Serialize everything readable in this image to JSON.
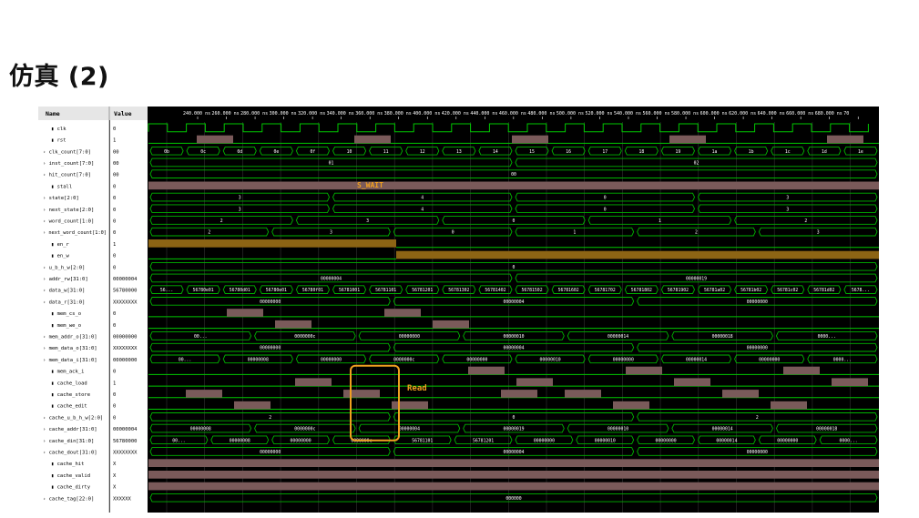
{
  "slide": {
    "title": "仿真 (2)"
  },
  "panel": {
    "name_header": "Name",
    "value_header": "Value"
  },
  "time_axis": [
    "240.000 ns",
    "260.000 ns",
    "280.000 ns",
    "300.000 ns",
    "320.000 ns",
    "340.000 ns",
    "360.000 ns",
    "380.000 ns",
    "400.000 ns",
    "420.000 ns",
    "440.000 ns",
    "460.000 ns",
    "480.000 ns",
    "500.000 ns",
    "520.000 ns",
    "540.000 ns",
    "560.000 ns",
    "580.000 ns",
    "600.000 ns",
    "620.000 ns",
    "640.000 ns",
    "660.000 ns",
    "680.000 ns",
    "70"
  ],
  "colors": {
    "signal_green": "#00c800",
    "bus_outline": "#00b400",
    "high_fill": "#7a5a5a",
    "en_r_fill": "#8c6414",
    "annotation_orange": "#f0a020",
    "background": "#000000"
  },
  "annotations": {
    "s_wait": "S_WAIT",
    "read": "Read"
  },
  "signals": [
    {
      "name": "clk",
      "value": "0",
      "kind": "bit"
    },
    {
      "name": "rst",
      "value": "1",
      "kind": "bit"
    },
    {
      "name": "clk_count[7:0]",
      "value": "00",
      "kind": "bus",
      "segs": [
        "0b",
        "0c",
        "0d",
        "0e",
        "0f",
        "10",
        "11",
        "12",
        "13",
        "14",
        "15",
        "16",
        "17",
        "18",
        "19",
        "1a",
        "1b",
        "1c",
        "1d",
        "1e"
      ]
    },
    {
      "name": "inst_count[7:0]",
      "value": "00",
      "kind": "bus",
      "segs": [
        "01",
        "02"
      ]
    },
    {
      "name": "hit_count[7:0]",
      "value": "00",
      "kind": "bus",
      "segs": [
        "00"
      ]
    },
    {
      "name": "stall",
      "value": "0",
      "kind": "bit"
    },
    {
      "name": "state[2:0]",
      "value": "0",
      "kind": "bus",
      "segs": [
        "3",
        "4",
        "0",
        "3"
      ]
    },
    {
      "name": "next_state[2:0]",
      "value": "0",
      "kind": "bus",
      "segs": [
        "3",
        "4",
        "0",
        "3"
      ]
    },
    {
      "name": "word_count[1:0]",
      "value": "0",
      "kind": "bus",
      "segs": [
        "2",
        "3",
        "0",
        "1",
        "2"
      ]
    },
    {
      "name": "next_word_count[1:0]",
      "value": "0",
      "kind": "bus",
      "segs": [
        "2",
        "3",
        "0",
        "1",
        "2",
        "3"
      ]
    },
    {
      "name": "en_r",
      "value": "1",
      "kind": "bit"
    },
    {
      "name": "en_w",
      "value": "0",
      "kind": "bit"
    },
    {
      "name": "u_b_h_w[2:0]",
      "value": "0",
      "kind": "bus",
      "segs": [
        "0"
      ]
    },
    {
      "name": "addr_rw[31:0]",
      "value": "00000004",
      "kind": "bus",
      "segs": [
        "00000004",
        "00000019"
      ]
    },
    {
      "name": "data_w[31:0]",
      "value": "56780000",
      "kind": "bus",
      "segs": [
        "56...",
        "56780e01",
        "56780d01",
        "56780e01",
        "56780f01",
        "56781001",
        "56781101",
        "56781201",
        "56781302",
        "56781402",
        "56781502",
        "56781602",
        "56781702",
        "56781802",
        "56781902",
        "56781a02",
        "56781b02",
        "56781c02",
        "56781d02",
        "5678..."
      ]
    },
    {
      "name": "data_r[31:0]",
      "value": "XXXXXXXX",
      "kind": "bus",
      "segs": [
        "00000000",
        "00000004",
        "00000000"
      ]
    },
    {
      "name": "mem_cs_o",
      "value": "0",
      "kind": "bit"
    },
    {
      "name": "mem_we_o",
      "value": "0",
      "kind": "bit"
    },
    {
      "name": "mem_addr_o[31:0]",
      "value": "00000000",
      "kind": "bus",
      "segs": [
        "00...",
        "0000000c",
        "00000000",
        "00000010",
        "00000014",
        "00000018",
        "0000..."
      ]
    },
    {
      "name": "mem_data_o[31:0]",
      "value": "XXXXXXXX",
      "kind": "bus",
      "segs": [
        "00000000",
        "00000004",
        "00000000"
      ]
    },
    {
      "name": "mem_data_i[31:0]",
      "value": "00000000",
      "kind": "bus",
      "segs": [
        "00...",
        "00000008",
        "00000000",
        "0000000c",
        "00000000",
        "00000010",
        "00000000",
        "00000014",
        "00000000",
        "0000..."
      ]
    },
    {
      "name": "mem_ack_i",
      "value": "0",
      "kind": "bit"
    },
    {
      "name": "cache_load",
      "value": "1",
      "kind": "bit"
    },
    {
      "name": "cache_store",
      "value": "0",
      "kind": "bit"
    },
    {
      "name": "cache_edit",
      "value": "0",
      "kind": "bit"
    },
    {
      "name": "cache_u_b_h_w[2:0]",
      "value": "0",
      "kind": "bus",
      "segs": [
        "2",
        "0",
        "2"
      ]
    },
    {
      "name": "cache_addr[31:0]",
      "value": "00000004",
      "kind": "bus",
      "segs": [
        "00000008",
        "0000000c",
        "00000004",
        "00000019",
        "00000010",
        "00000014",
        "00000018"
      ]
    },
    {
      "name": "cache_din[31:0]",
      "value": "56780000",
      "kind": "bus",
      "segs": [
        "00...",
        "00000008",
        "00000000",
        "0000000c",
        "56781101",
        "56781201",
        "00000000",
        "00000010",
        "00000000",
        "00000014",
        "00000000",
        "0000..."
      ]
    },
    {
      "name": "cache_dout[31:0]",
      "value": "XXXXXXXX",
      "kind": "bus",
      "segs": [
        "00000000",
        "00000004",
        "00000000"
      ]
    },
    {
      "name": "cache_hit",
      "value": "X",
      "kind": "bit"
    },
    {
      "name": "cache_valid",
      "value": "X",
      "kind": "bit"
    },
    {
      "name": "cache_dirty",
      "value": "X",
      "kind": "bit"
    },
    {
      "name": "cache_tag[22:0]",
      "value": "XXXXXX",
      "kind": "bus",
      "segs": [
        "000000"
      ]
    }
  ]
}
